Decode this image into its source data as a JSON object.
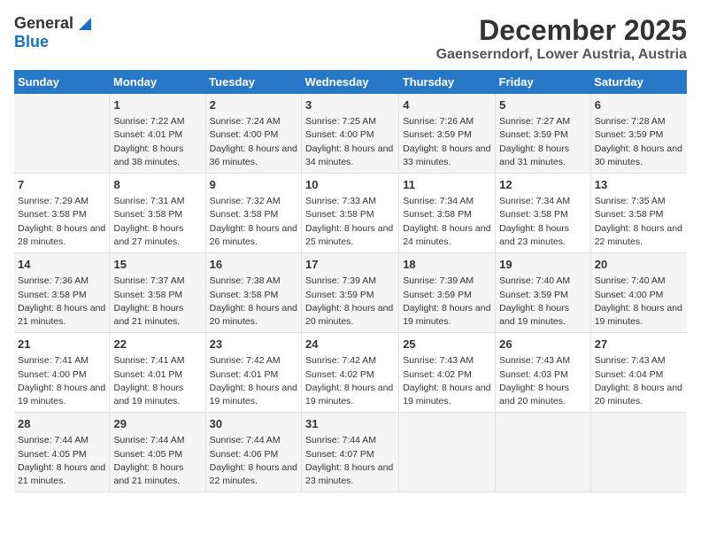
{
  "header": {
    "logo_general": "General",
    "logo_blue": "Blue",
    "month": "December 2025",
    "location": "Gaenserndorf, Lower Austria, Austria"
  },
  "weekdays": [
    "Sunday",
    "Monday",
    "Tuesday",
    "Wednesday",
    "Thursday",
    "Friday",
    "Saturday"
  ],
  "weeks": [
    [
      {
        "day": "",
        "sunrise": "",
        "sunset": "",
        "daylight": ""
      },
      {
        "day": "1",
        "sunrise": "Sunrise: 7:22 AM",
        "sunset": "Sunset: 4:01 PM",
        "daylight": "Daylight: 8 hours and 38 minutes."
      },
      {
        "day": "2",
        "sunrise": "Sunrise: 7:24 AM",
        "sunset": "Sunset: 4:00 PM",
        "daylight": "Daylight: 8 hours and 36 minutes."
      },
      {
        "day": "3",
        "sunrise": "Sunrise: 7:25 AM",
        "sunset": "Sunset: 4:00 PM",
        "daylight": "Daylight: 8 hours and 34 minutes."
      },
      {
        "day": "4",
        "sunrise": "Sunrise: 7:26 AM",
        "sunset": "Sunset: 3:59 PM",
        "daylight": "Daylight: 8 hours and 33 minutes."
      },
      {
        "day": "5",
        "sunrise": "Sunrise: 7:27 AM",
        "sunset": "Sunset: 3:59 PM",
        "daylight": "Daylight: 8 hours and 31 minutes."
      },
      {
        "day": "6",
        "sunrise": "Sunrise: 7:28 AM",
        "sunset": "Sunset: 3:59 PM",
        "daylight": "Daylight: 8 hours and 30 minutes."
      }
    ],
    [
      {
        "day": "7",
        "sunrise": "Sunrise: 7:29 AM",
        "sunset": "Sunset: 3:58 PM",
        "daylight": "Daylight: 8 hours and 28 minutes."
      },
      {
        "day": "8",
        "sunrise": "Sunrise: 7:31 AM",
        "sunset": "Sunset: 3:58 PM",
        "daylight": "Daylight: 8 hours and 27 minutes."
      },
      {
        "day": "9",
        "sunrise": "Sunrise: 7:32 AM",
        "sunset": "Sunset: 3:58 PM",
        "daylight": "Daylight: 8 hours and 26 minutes."
      },
      {
        "day": "10",
        "sunrise": "Sunrise: 7:33 AM",
        "sunset": "Sunset: 3:58 PM",
        "daylight": "Daylight: 8 hours and 25 minutes."
      },
      {
        "day": "11",
        "sunrise": "Sunrise: 7:34 AM",
        "sunset": "Sunset: 3:58 PM",
        "daylight": "Daylight: 8 hours and 24 minutes."
      },
      {
        "day": "12",
        "sunrise": "Sunrise: 7:34 AM",
        "sunset": "Sunset: 3:58 PM",
        "daylight": "Daylight: 8 hours and 23 minutes."
      },
      {
        "day": "13",
        "sunrise": "Sunrise: 7:35 AM",
        "sunset": "Sunset: 3:58 PM",
        "daylight": "Daylight: 8 hours and 22 minutes."
      }
    ],
    [
      {
        "day": "14",
        "sunrise": "Sunrise: 7:36 AM",
        "sunset": "Sunset: 3:58 PM",
        "daylight": "Daylight: 8 hours and 21 minutes."
      },
      {
        "day": "15",
        "sunrise": "Sunrise: 7:37 AM",
        "sunset": "Sunset: 3:58 PM",
        "daylight": "Daylight: 8 hours and 21 minutes."
      },
      {
        "day": "16",
        "sunrise": "Sunrise: 7:38 AM",
        "sunset": "Sunset: 3:58 PM",
        "daylight": "Daylight: 8 hours and 20 minutes."
      },
      {
        "day": "17",
        "sunrise": "Sunrise: 7:39 AM",
        "sunset": "Sunset: 3:59 PM",
        "daylight": "Daylight: 8 hours and 20 minutes."
      },
      {
        "day": "18",
        "sunrise": "Sunrise: 7:39 AM",
        "sunset": "Sunset: 3:59 PM",
        "daylight": "Daylight: 8 hours and 19 minutes."
      },
      {
        "day": "19",
        "sunrise": "Sunrise: 7:40 AM",
        "sunset": "Sunset: 3:59 PM",
        "daylight": "Daylight: 8 hours and 19 minutes."
      },
      {
        "day": "20",
        "sunrise": "Sunrise: 7:40 AM",
        "sunset": "Sunset: 4:00 PM",
        "daylight": "Daylight: 8 hours and 19 minutes."
      }
    ],
    [
      {
        "day": "21",
        "sunrise": "Sunrise: 7:41 AM",
        "sunset": "Sunset: 4:00 PM",
        "daylight": "Daylight: 8 hours and 19 minutes."
      },
      {
        "day": "22",
        "sunrise": "Sunrise: 7:41 AM",
        "sunset": "Sunset: 4:01 PM",
        "daylight": "Daylight: 8 hours and 19 minutes."
      },
      {
        "day": "23",
        "sunrise": "Sunrise: 7:42 AM",
        "sunset": "Sunset: 4:01 PM",
        "daylight": "Daylight: 8 hours and 19 minutes."
      },
      {
        "day": "24",
        "sunrise": "Sunrise: 7:42 AM",
        "sunset": "Sunset: 4:02 PM",
        "daylight": "Daylight: 8 hours and 19 minutes."
      },
      {
        "day": "25",
        "sunrise": "Sunrise: 7:43 AM",
        "sunset": "Sunset: 4:02 PM",
        "daylight": "Daylight: 8 hours and 19 minutes."
      },
      {
        "day": "26",
        "sunrise": "Sunrise: 7:43 AM",
        "sunset": "Sunset: 4:03 PM",
        "daylight": "Daylight: 8 hours and 20 minutes."
      },
      {
        "day": "27",
        "sunrise": "Sunrise: 7:43 AM",
        "sunset": "Sunset: 4:04 PM",
        "daylight": "Daylight: 8 hours and 20 minutes."
      }
    ],
    [
      {
        "day": "28",
        "sunrise": "Sunrise: 7:44 AM",
        "sunset": "Sunset: 4:05 PM",
        "daylight": "Daylight: 8 hours and 21 minutes."
      },
      {
        "day": "29",
        "sunrise": "Sunrise: 7:44 AM",
        "sunset": "Sunset: 4:05 PM",
        "daylight": "Daylight: 8 hours and 21 minutes."
      },
      {
        "day": "30",
        "sunrise": "Sunrise: 7:44 AM",
        "sunset": "Sunset: 4:06 PM",
        "daylight": "Daylight: 8 hours and 22 minutes."
      },
      {
        "day": "31",
        "sunrise": "Sunrise: 7:44 AM",
        "sunset": "Sunset: 4:07 PM",
        "daylight": "Daylight: 8 hours and 23 minutes."
      },
      {
        "day": "",
        "sunrise": "",
        "sunset": "",
        "daylight": ""
      },
      {
        "day": "",
        "sunrise": "",
        "sunset": "",
        "daylight": ""
      },
      {
        "day": "",
        "sunrise": "",
        "sunset": "",
        "daylight": ""
      }
    ]
  ]
}
